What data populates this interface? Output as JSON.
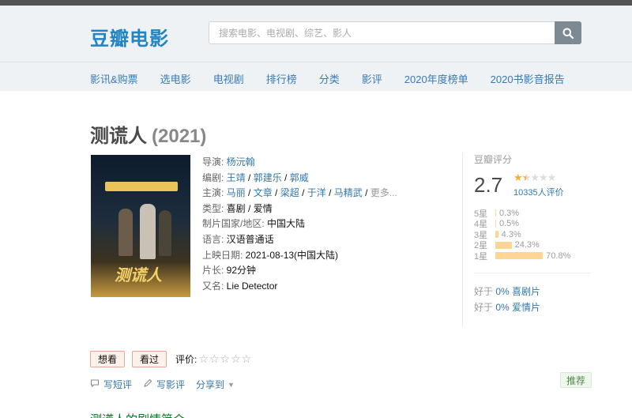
{
  "header": {
    "logo": "豆瓣电影",
    "search_placeholder": "搜索电影、电视剧、综艺、影人"
  },
  "nav": [
    "影讯&购票",
    "选电影",
    "电视剧",
    "排行榜",
    "分类",
    "影评",
    "2020年度榜单",
    "2020书影音报告"
  ],
  "movie": {
    "title": "测谎人",
    "year": "(2021)",
    "poster_title": "测谎人"
  },
  "info": {
    "director_label": "导演: ",
    "director": "杨沅翰",
    "writer_label": "编剧: ",
    "writers": [
      "王靖",
      "郭建乐",
      "郭威"
    ],
    "cast_label": "主演: ",
    "cast": [
      "马丽",
      "文章",
      "梁超",
      "于洋",
      "马精武"
    ],
    "cast_more": "更多...",
    "genre_label": "类型: ",
    "genres": [
      "喜剧",
      "爱情"
    ],
    "country_label": "制片国家/地区: ",
    "country": "中国大陆",
    "language_label": "语言: ",
    "language": "汉语普通话",
    "release_label": "上映日期: ",
    "release": "2021-08-13(中国大陆)",
    "runtime_label": "片长: ",
    "runtime": "92分钟",
    "aka_label": "又名: ",
    "aka": "Lie Detector"
  },
  "rating": {
    "title": "豆瓣评分",
    "score": "2.7",
    "stars": 1.5,
    "votes": "10335人评价",
    "distribution": [
      {
        "label": "5星",
        "percent": 0.3,
        "text": "0.3%"
      },
      {
        "label": "4星",
        "percent": 0.5,
        "text": "0.5%"
      },
      {
        "label": "3星",
        "percent": 4.3,
        "text": "4.3%"
      },
      {
        "label": "2星",
        "percent": 24.3,
        "text": "24.3%"
      },
      {
        "label": "1星",
        "percent": 70.8,
        "text": "70.8%"
      }
    ],
    "better_than": [
      {
        "prefix": "好于 ",
        "percent": "0%",
        "genre": "喜剧片"
      },
      {
        "prefix": "好于 ",
        "percent": "0%",
        "genre": "爱情片"
      }
    ]
  },
  "actions": {
    "want": "想看",
    "watched": "看过",
    "rate_label": "评价:",
    "short_review": "写短评",
    "review": "写影评",
    "share": "分享到",
    "recommend": "推荐"
  },
  "section": {
    "subhead": "测谎人的剧情简介 · · · · · ·"
  }
}
